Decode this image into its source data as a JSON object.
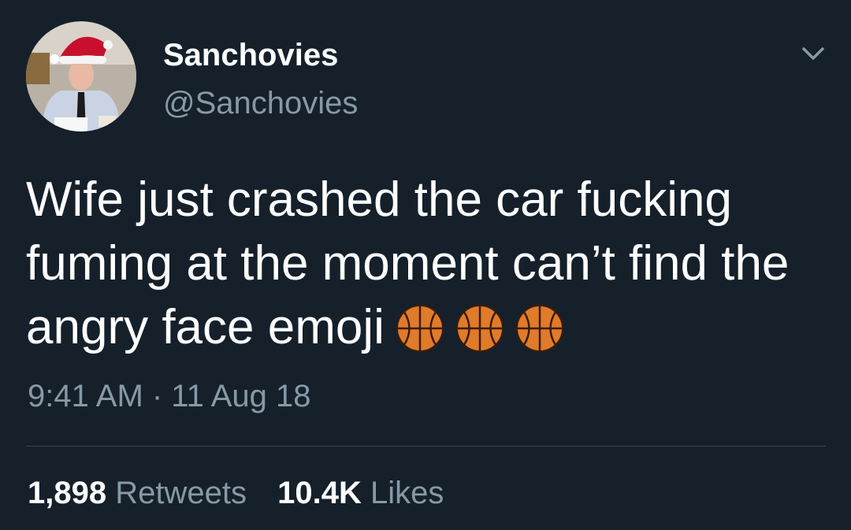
{
  "author": {
    "display_name": "Sanchovies",
    "handle": "@Sanchovies"
  },
  "tweet": {
    "text": "Wife just crashed the car fucking fuming at the moment can’t find the angry face emoji",
    "emoji_count": 3,
    "emoji_icon": "basketball-icon",
    "timestamp": "9:41 AM · 11 Aug 18"
  },
  "stats": {
    "retweets_count": "1,898",
    "retweets_label": "Retweets",
    "likes_count": "10.4K",
    "likes_label": "Likes"
  },
  "colors": {
    "background": "#15202b",
    "primary_text": "#ffffff",
    "secondary_text": "#8899a6",
    "divider": "#38444d",
    "basketball": "#e07b2a"
  }
}
